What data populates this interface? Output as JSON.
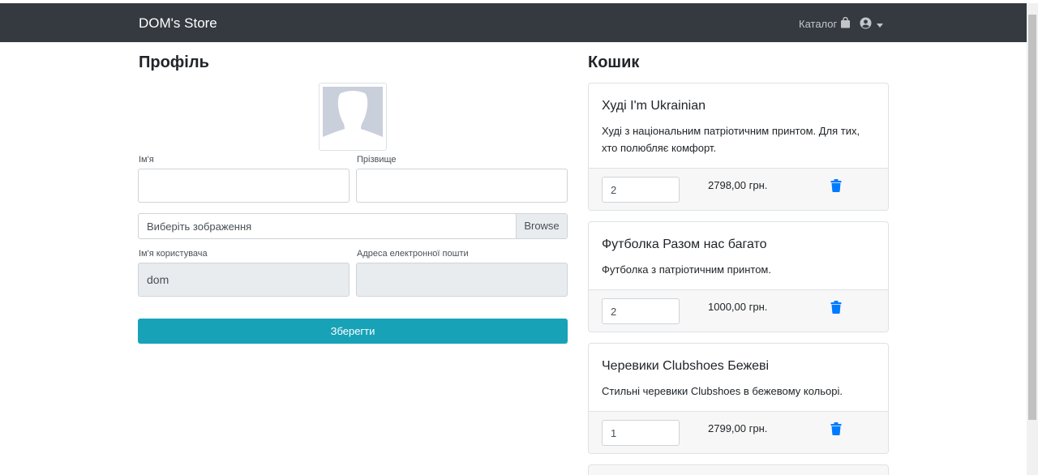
{
  "navbar": {
    "brand": "DOM's Store",
    "catalog_label": "Каталог"
  },
  "profile": {
    "heading": "Профіль",
    "first_name_label": "Ім'я",
    "last_name_label": "Прізвище",
    "file_placeholder": "Виберіть зображення",
    "browse_label": "Browse",
    "username_label": "Ім'я користувача",
    "username_value": "dom",
    "email_label": "Адреса електронної пошти",
    "email_value": "",
    "save_label": "Зберегти"
  },
  "cart": {
    "heading": "Кошик",
    "items": [
      {
        "title": "Худі I'm Ukrainian",
        "description": "Худі з національним патріотичним принтом. Для тих, хто полюбляє комфорт.",
        "quantity": "2",
        "price": "2798,00 грн."
      },
      {
        "title": "Футболка Разом нас багато",
        "description": "Футболка з патріотичним принтом.",
        "quantity": "2",
        "price": "1000,00 грн."
      },
      {
        "title": "Черевики Clubshoes Бежеві",
        "description": "Стильні черевики Clubshoes в бежевому кольорі.",
        "quantity": "1",
        "price": "2799,00 грн."
      }
    ]
  },
  "colors": {
    "navbar_bg": "#343a40",
    "save_button": "#17a2b8",
    "trash_icon": "#007bff"
  },
  "icons": {
    "catalog": "shopping-bag-icon",
    "user": "user-circle-icon",
    "trash": "trash-icon"
  }
}
